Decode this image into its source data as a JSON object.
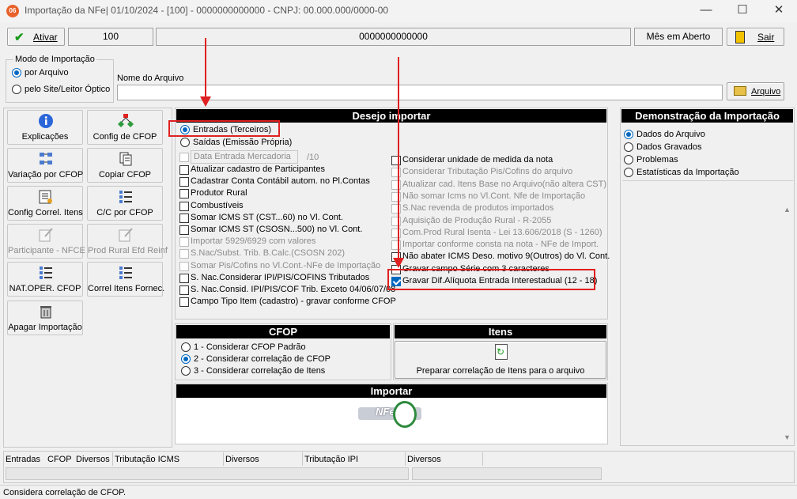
{
  "window": {
    "title": "Importação da NFe| 01/10/2024 - [100] - 0000000000000 - CNPJ: 00.000.000/0000-00",
    "app_icon_text": "06"
  },
  "toolbar": {
    "ativar_label": "Ativar",
    "field_100": "100",
    "field_code": "0000000000000",
    "mes_label": "Mês em Aberto",
    "sair_label": "Sair"
  },
  "modo": {
    "title": "Modo de Importação",
    "options": [
      "por Arquivo",
      "pelo Site/Leitor Óptico"
    ],
    "selected": 0
  },
  "arquivo": {
    "label": "Nome do Arquivo",
    "value": "",
    "button_label": "Arquivo"
  },
  "tiles": [
    {
      "label": "Explicações",
      "icon": "info-icon",
      "enabled": true
    },
    {
      "label": "Config de CFOP",
      "icon": "tree-icon",
      "enabled": true
    },
    {
      "label": "Variação por CFOP",
      "icon": "grid-icon",
      "enabled": true
    },
    {
      "label": "Copiar CFOP",
      "icon": "copy-icon",
      "enabled": true
    },
    {
      "label": "Config Correl. Itens",
      "icon": "config-list-icon",
      "enabled": true
    },
    {
      "label": "C/C por CFOP",
      "icon": "list-icon",
      "enabled": true
    },
    {
      "label": "Participante - NFCE",
      "icon": "edit-icon",
      "enabled": false
    },
    {
      "label": "Prod Rural Efd Reinf",
      "icon": "edit-icon",
      "enabled": false
    },
    {
      "label": "NAT.OPER. CFOP",
      "icon": "list-icon",
      "enabled": true
    },
    {
      "label": "Correl Itens Fornec.",
      "icon": "list-icon",
      "enabled": true
    },
    {
      "label": "Apagar Importação",
      "icon": "trash-icon",
      "enabled": true
    }
  ],
  "desejo": {
    "title": "Desejo importar",
    "radios": [
      "Entradas (Terceiros)",
      "Saídas (Emissão Própria)"
    ],
    "selected": 0,
    "data_entrada_label": "Data Entrada Mercadoria",
    "data_entrada_value": "/10",
    "left_checks": [
      {
        "label": "Atualizar cadastro de Participantes",
        "checked": false,
        "enabled": true
      },
      {
        "label": "Cadastrar Conta Contábil autom. no Pl.Contas",
        "checked": false,
        "enabled": true
      },
      {
        "label": "Produtor Rural",
        "checked": false,
        "enabled": true
      },
      {
        "label": "Combustíveis",
        "checked": false,
        "enabled": true
      },
      {
        "label": "Somar ICMS ST (CST...60) no Vl. Cont.",
        "checked": false,
        "enabled": true
      },
      {
        "label": "Somar ICMS ST (CSOSN...500) no Vl. Cont.",
        "checked": false,
        "enabled": true
      },
      {
        "label": "Importar 5929/6929 com valores",
        "checked": false,
        "enabled": false
      },
      {
        "label": "S.Nac/Subst. Trib. B.Calc.(CSOSN 202)",
        "checked": false,
        "enabled": false
      },
      {
        "label": "Somar Pis/Cofins no Vl.Cont.-NFe de Importação",
        "checked": false,
        "enabled": false
      },
      {
        "label": "S. Nac.Considerar IPI/PIS/COFINS Tributados",
        "checked": false,
        "enabled": true
      },
      {
        "label": "S. Nac.Consid. IPI/PIS/COF Trib. Exceto 04/06/07/08",
        "checked": false,
        "enabled": true
      },
      {
        "label": "Campo Tipo Item (cadastro) - gravar conforme CFOP",
        "checked": false,
        "enabled": true
      }
    ],
    "right_checks": [
      {
        "label": "Considerar unidade de medida da nota",
        "checked": false,
        "enabled": true
      },
      {
        "label": "Considerar Tributação Pis/Cofins do arquivo",
        "checked": false,
        "enabled": false
      },
      {
        "label": "Atualizar cad. Itens Base no Arquivo(não altera CST)",
        "checked": false,
        "enabled": false
      },
      {
        "label": "Não somar Icms no Vl.Cont. Nfe de Importação",
        "checked": false,
        "enabled": false
      },
      {
        "label": "S.Nac revenda de produtos importados",
        "checked": false,
        "enabled": false
      },
      {
        "label": "Aquisição de Produção Rural - R-2055",
        "checked": false,
        "enabled": false
      },
      {
        "label": "Com.Prod Rural Isenta - Lei 13.606/2018 (S - 1260)",
        "checked": false,
        "enabled": false
      },
      {
        "label": "Importar conforme consta na nota - NFe de Import.",
        "checked": false,
        "enabled": false
      },
      {
        "label": "Não abater ICMS Deso. motivo 9(Outros) do Vl. Cont.",
        "checked": false,
        "enabled": true
      },
      {
        "label": "Gravar campo Série com 3 caracteres",
        "checked": false,
        "enabled": true
      },
      {
        "label": "Gravar Dif.Alíquota Entrada Interestadual (12 - 18)",
        "checked": true,
        "enabled": true
      }
    ]
  },
  "cfop": {
    "title": "CFOP",
    "options": [
      "1 - Considerar CFOP Padrão",
      "2 - Considerar correlação de CFOP",
      "3 - Considerar correlação de Itens"
    ],
    "selected": 1
  },
  "itens": {
    "title": "Itens",
    "button_label": "Preparar correlação de Itens para o arquivo"
  },
  "importar": {
    "title": "Importar",
    "logo_text": "NFe"
  },
  "demonstracao": {
    "title": "Demonstração da Importação",
    "options": [
      "Dados do Arquivo",
      "Dados Gravados",
      "Problemas",
      "Estatísticas da Importação"
    ],
    "selected": 0
  },
  "grid_header": [
    "Entradas",
    "CFOP",
    "Diversos",
    "Tributação ICMS",
    "Diversos",
    "Tributação IPI",
    "Diversos"
  ],
  "status": {
    "text": "Considera correlação de CFOP."
  }
}
